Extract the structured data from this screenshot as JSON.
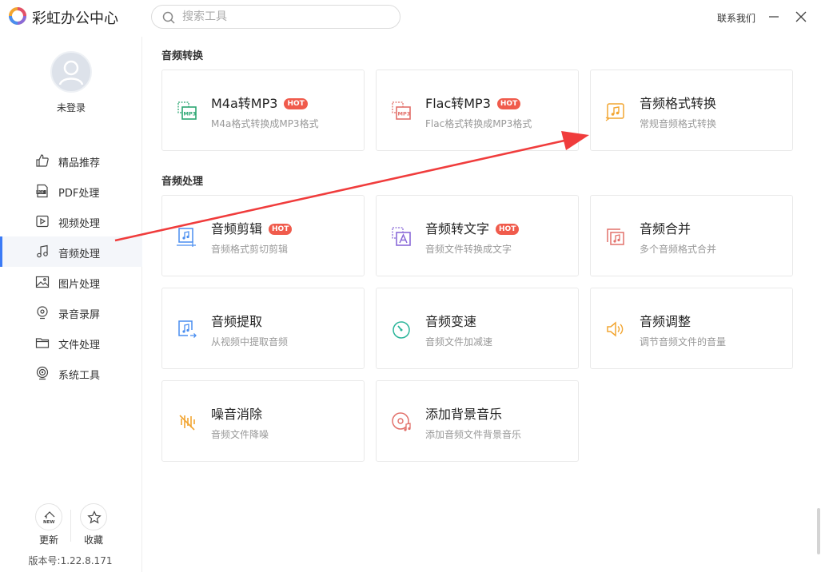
{
  "app": {
    "title": "彩虹办公中心",
    "contact_label": "联系我们"
  },
  "search": {
    "placeholder": "搜索工具"
  },
  "user": {
    "login_label": "未登录"
  },
  "sidebar": {
    "items": [
      {
        "label": "精品推荐",
        "icon": "thumbs-up-icon"
      },
      {
        "label": "PDF处理",
        "icon": "pdf-icon"
      },
      {
        "label": "视频处理",
        "icon": "video-icon"
      },
      {
        "label": "音频处理",
        "icon": "music-note-icon",
        "active": true
      },
      {
        "label": "图片处理",
        "icon": "image-icon"
      },
      {
        "label": "录音录屏",
        "icon": "record-icon"
      },
      {
        "label": "文件处理",
        "icon": "folder-icon"
      },
      {
        "label": "系统工具",
        "icon": "system-tool-icon"
      }
    ],
    "footer": {
      "update_label": "更新",
      "update_badge": "NEW",
      "favorite_label": "收藏",
      "version": "版本号:1.22.8.171"
    }
  },
  "sections": [
    {
      "title": "音频转换",
      "cards": [
        {
          "title": "M4a转MP3",
          "desc": "M4a格式转换成MP3格式",
          "hot": "HOT",
          "icon": "m4a-to-mp3-icon",
          "icon_text": "MP3",
          "color": "#2ba672"
        },
        {
          "title": "Flac转MP3",
          "desc": "Flac格式转换成MP3格式",
          "hot": "HOT",
          "icon": "flac-to-mp3-icon",
          "icon_text": "MP3",
          "color": "#e2706a"
        },
        {
          "title": "音频格式转换",
          "desc": "常规音频格式转换",
          "hot": "",
          "icon": "audio-convert-icon",
          "color": "#f2a531"
        }
      ]
    },
    {
      "title": "音频处理",
      "cards": [
        {
          "title": "音频剪辑",
          "desc": "音频格式剪切剪辑",
          "hot": "HOT",
          "icon": "audio-cut-icon",
          "color": "#4a8ef0"
        },
        {
          "title": "音频转文字",
          "desc": "音频文件转换成文字",
          "hot": "HOT",
          "icon": "audio-to-text-icon",
          "color": "#8a6ad8"
        },
        {
          "title": "音频合并",
          "desc": "多个音频格式合并",
          "hot": "",
          "icon": "audio-merge-icon",
          "color": "#e2706a"
        },
        {
          "title": "音频提取",
          "desc": "从视频中提取音频",
          "hot": "",
          "icon": "audio-extract-icon",
          "color": "#4a8ef0"
        },
        {
          "title": "音频变速",
          "desc": "音频文件加减速",
          "hot": "",
          "icon": "audio-speed-icon",
          "color": "#2bb59a"
        },
        {
          "title": "音频调整",
          "desc": "调节音频文件的音量",
          "hot": "",
          "icon": "volume-icon",
          "color": "#f2a531"
        },
        {
          "title": "噪音消除",
          "desc": "音频文件降噪",
          "hot": "",
          "icon": "noise-reduction-icon",
          "color": "#f2a531"
        },
        {
          "title": "添加背景音乐",
          "desc": "添加音频文件背景音乐",
          "hot": "",
          "icon": "background-music-icon",
          "color": "#e2706a"
        }
      ]
    }
  ],
  "annotation": {
    "color": "#f03c3c",
    "from": "音频处理",
    "to": "音频格式转换"
  }
}
